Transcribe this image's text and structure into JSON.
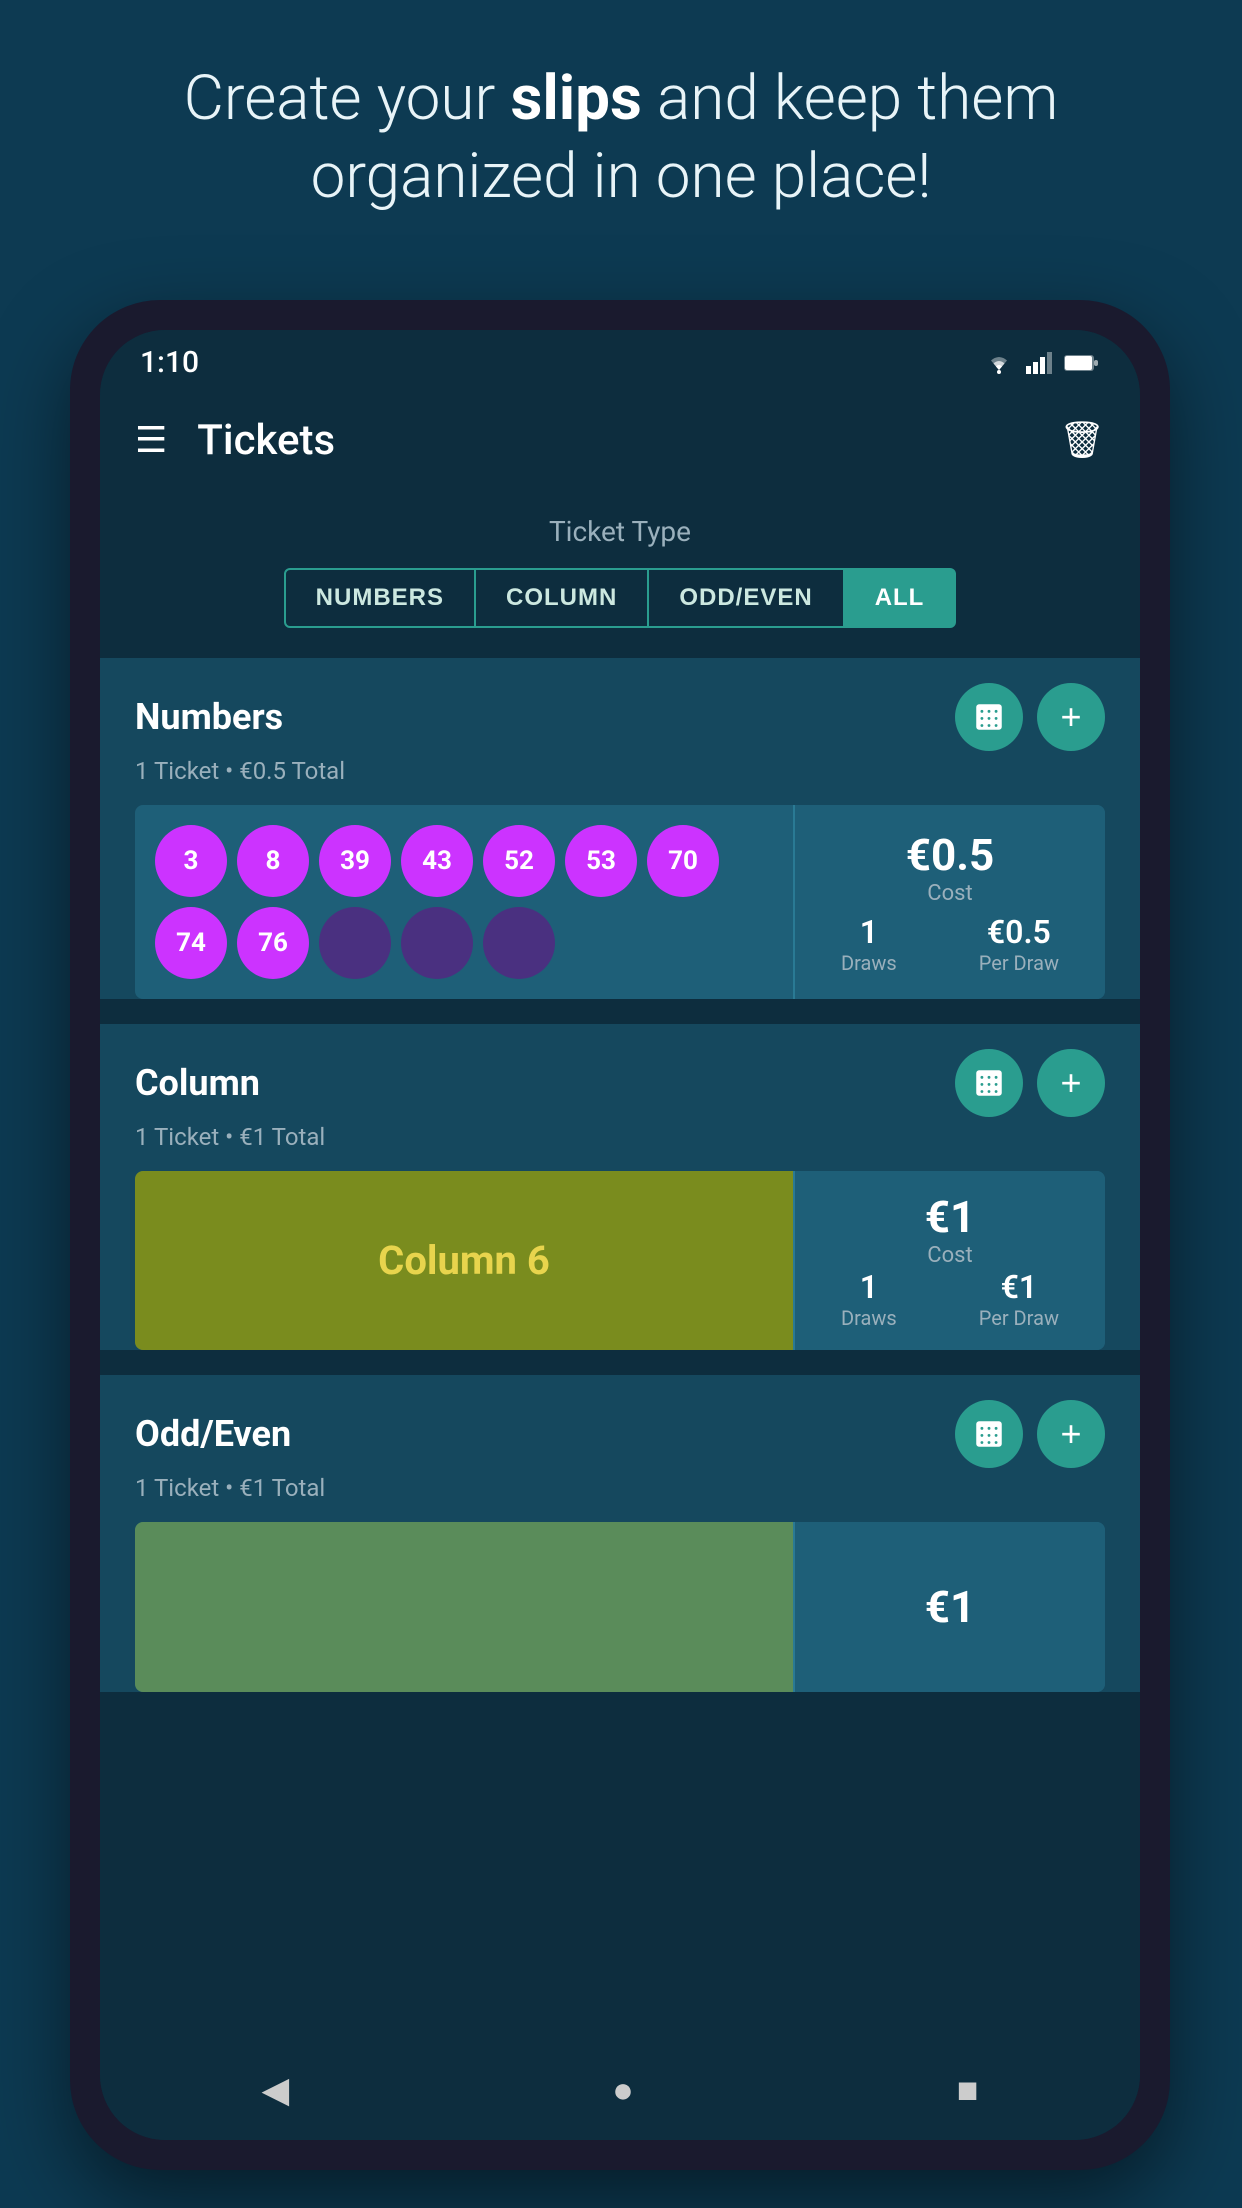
{
  "hero": {
    "text_part1": "Create your ",
    "text_bold": "slips",
    "text_part2": " and keep them organized in one place!"
  },
  "status_bar": {
    "time": "1:10"
  },
  "top_bar": {
    "title": "Tickets"
  },
  "ticket_type": {
    "label": "Ticket Type"
  },
  "tabs": [
    {
      "label": "NUMBERS",
      "active": false
    },
    {
      "label": "COLUMN",
      "active": false
    },
    {
      "label": "ODD/EVEN",
      "active": false
    },
    {
      "label": "ALL",
      "active": true
    }
  ],
  "sections": {
    "numbers": {
      "title": "Numbers",
      "subtitle": "1 Ticket • €0.5 Total",
      "ticket": {
        "balls_purple": [
          "3",
          "8",
          "39",
          "43",
          "52",
          "53",
          "70",
          "74",
          "76"
        ],
        "balls_empty": 3,
        "cost": "€0.5",
        "cost_label": "Cost",
        "draws_value": "1",
        "draws_label": "Draws",
        "per_draw_value": "€0.5",
        "per_draw_label": "Per Draw"
      }
    },
    "column": {
      "title": "Column",
      "subtitle": "1 Ticket • €1 Total",
      "ticket": {
        "column_name": "Column 6",
        "cost": "€1",
        "cost_label": "Cost",
        "draws_value": "1",
        "draws_label": "Draws",
        "per_draw_value": "€1",
        "per_draw_label": "Per Draw"
      }
    },
    "odd_even": {
      "title": "Odd/Even",
      "subtitle": "1 Ticket • €1 Total",
      "ticket": {
        "cost": "€1"
      }
    }
  },
  "nav": {
    "back": "◀",
    "home": "●",
    "square": "■"
  }
}
